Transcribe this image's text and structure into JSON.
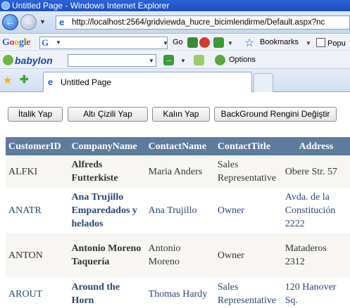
{
  "window": {
    "title": "Untitled Page - Windows Internet Explorer"
  },
  "address": {
    "url": "http://localhost:2564/gridviewda_hucre_bicimlendirme/Default.aspx?nc"
  },
  "googlebar": {
    "logo": "Google",
    "go": "Go",
    "bookmarks": "Bookmarks",
    "popups": "Popu"
  },
  "babylonbar": {
    "logo": "babylon",
    "options": "Options"
  },
  "tabs": [
    {
      "label": "Untitled Page"
    }
  ],
  "buttons": {
    "italic": "İtalik Yap",
    "underline": "Altı Çizili Yap",
    "bold": "Kalın Yap",
    "background": "BackGround Rengini Değiştir"
  },
  "grid": {
    "headers": [
      "CustomerID",
      "CompanyName",
      "ContactName",
      "ContactTitle",
      "Address"
    ],
    "rows": [
      {
        "id": "ALFKI",
        "company": "Alfreds Futterkiste",
        "contact": "Maria Anders",
        "title": "Sales Representative",
        "address": "Obere Str. 57"
      },
      {
        "id": "ANATR",
        "company": "Ana Trujillo Emparedados y helados",
        "contact": "Ana Trujillo",
        "title": "Owner",
        "address": "Avda. de la Constitución 2222"
      },
      {
        "id": "ANTON",
        "company": "Antonio Moreno Taquería",
        "contact": "Antonio Moreno",
        "title": "Owner",
        "address": "Mataderos 2312"
      },
      {
        "id": "AROUT",
        "company": "Around the Horn",
        "contact": "Thomas Hardy",
        "title": "Sales Representative",
        "address": "120 Hanover Sq."
      }
    ]
  },
  "colors": {
    "grid_header": "#5d7b9d",
    "row_odd": "#f7f6f3",
    "text_odd": "#333333",
    "text_even": "#284775"
  }
}
